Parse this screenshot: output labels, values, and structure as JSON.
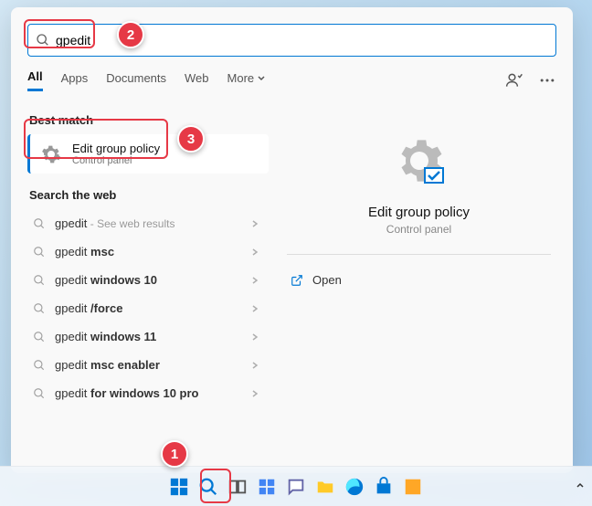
{
  "search": {
    "value": "gpedit"
  },
  "tabs": {
    "all": "All",
    "apps": "Apps",
    "documents": "Documents",
    "web": "Web",
    "more": "More"
  },
  "bestMatch": {
    "label": "Best match",
    "title": "Edit group policy",
    "subtitle": "Control panel"
  },
  "webSearch": {
    "label": "Search the web",
    "items": [
      {
        "prefix": "gpedit",
        "suffix": "",
        "hint": " - See web results"
      },
      {
        "prefix": "gpedit ",
        "suffix": "msc",
        "hint": ""
      },
      {
        "prefix": "gpedit ",
        "suffix": "windows 10",
        "hint": ""
      },
      {
        "prefix": "gpedit ",
        "suffix": "/force",
        "hint": ""
      },
      {
        "prefix": "gpedit ",
        "suffix": "windows 11",
        "hint": ""
      },
      {
        "prefix": "gpedit ",
        "suffix": "msc enabler",
        "hint": ""
      },
      {
        "prefix": "gpedit ",
        "suffix": "for windows 10 pro",
        "hint": ""
      }
    ]
  },
  "preview": {
    "title": "Edit group policy",
    "subtitle": "Control panel",
    "open": "Open"
  },
  "callouts": {
    "c1": "1",
    "c2": "2",
    "c3": "3"
  }
}
